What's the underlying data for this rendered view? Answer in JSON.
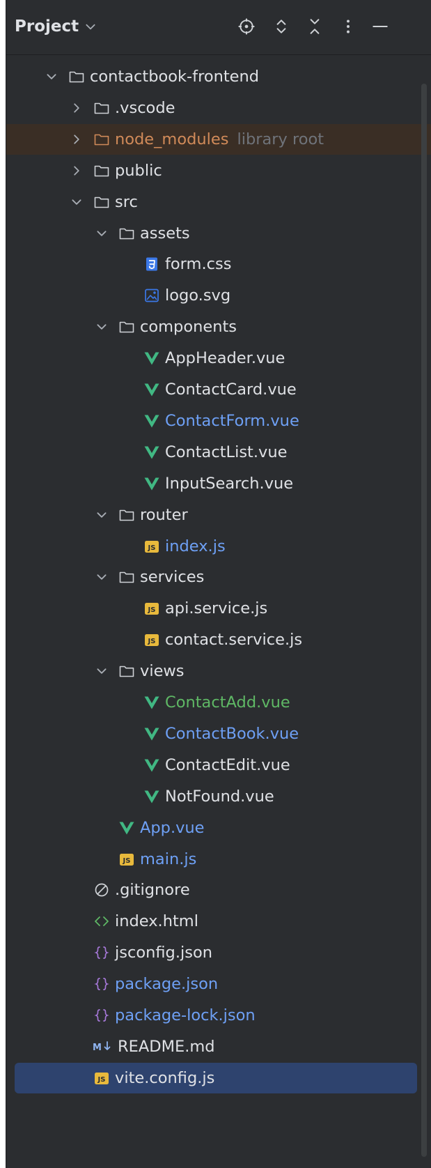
{
  "header": {
    "title": "Project",
    "icons": [
      "chevron-down-icon",
      "locate-icon",
      "expand-all-icon",
      "collapse-all-icon",
      "more-options-icon",
      "minimize-icon"
    ]
  },
  "colors": {
    "panel_bg": "#2b2d30",
    "text_default": "#dfe1e5",
    "text_modified": "#6ea0f5",
    "text_added": "#5fb865",
    "text_excluded": "#d08a59",
    "hint": "#6f737a",
    "selection": "#2e436e",
    "excluded_row": "#3a2e25",
    "vue_green": "#41b883",
    "js_yellow": "#e8b93c",
    "css_blue": "#3b78e7",
    "json_purple": "#a678d8"
  },
  "tree": {
    "rows": [
      {
        "label": "contactbook-frontend",
        "level": 0,
        "arrow": "expanded",
        "icon": "folder-icon",
        "status": "default"
      },
      {
        "label": ".vscode",
        "level": 1,
        "arrow": "collapsed",
        "icon": "folder-icon",
        "status": "default"
      },
      {
        "label": "node_modules",
        "level": 1,
        "arrow": "collapsed",
        "icon": "folder-excluded-icon",
        "status": "excluded",
        "hint": "library root"
      },
      {
        "label": "public",
        "level": 1,
        "arrow": "collapsed",
        "icon": "folder-icon",
        "status": "default"
      },
      {
        "label": "src",
        "level": 1,
        "arrow": "expanded",
        "icon": "folder-icon",
        "status": "default"
      },
      {
        "label": "assets",
        "level": 2,
        "arrow": "expanded",
        "icon": "folder-icon",
        "status": "default"
      },
      {
        "label": "form.css",
        "level": 3,
        "arrow": "none",
        "icon": "css-file-icon",
        "status": "default"
      },
      {
        "label": "logo.svg",
        "level": 3,
        "arrow": "none",
        "icon": "image-file-icon",
        "status": "default"
      },
      {
        "label": "components",
        "level": 2,
        "arrow": "expanded",
        "icon": "folder-icon",
        "status": "default"
      },
      {
        "label": "AppHeader.vue",
        "level": 3,
        "arrow": "none",
        "icon": "vue-file-icon",
        "status": "default"
      },
      {
        "label": "ContactCard.vue",
        "level": 3,
        "arrow": "none",
        "icon": "vue-file-icon",
        "status": "default"
      },
      {
        "label": "ContactForm.vue",
        "level": 3,
        "arrow": "none",
        "icon": "vue-file-icon",
        "status": "modified"
      },
      {
        "label": "ContactList.vue",
        "level": 3,
        "arrow": "none",
        "icon": "vue-file-icon",
        "status": "default"
      },
      {
        "label": "InputSearch.vue",
        "level": 3,
        "arrow": "none",
        "icon": "vue-file-icon",
        "status": "default"
      },
      {
        "label": "router",
        "level": 2,
        "arrow": "expanded",
        "icon": "folder-icon",
        "status": "default"
      },
      {
        "label": "index.js",
        "level": 3,
        "arrow": "none",
        "icon": "js-file-icon",
        "status": "modified"
      },
      {
        "label": "services",
        "level": 2,
        "arrow": "expanded",
        "icon": "folder-icon",
        "status": "default"
      },
      {
        "label": "api.service.js",
        "level": 3,
        "arrow": "none",
        "icon": "js-file-icon",
        "status": "default"
      },
      {
        "label": "contact.service.js",
        "level": 3,
        "arrow": "none",
        "icon": "js-file-icon",
        "status": "default"
      },
      {
        "label": "views",
        "level": 2,
        "arrow": "expanded",
        "icon": "folder-icon",
        "status": "default"
      },
      {
        "label": "ContactAdd.vue",
        "level": 3,
        "arrow": "none",
        "icon": "vue-file-icon",
        "status": "added"
      },
      {
        "label": "ContactBook.vue",
        "level": 3,
        "arrow": "none",
        "icon": "vue-file-icon",
        "status": "modified"
      },
      {
        "label": "ContactEdit.vue",
        "level": 3,
        "arrow": "none",
        "icon": "vue-file-icon",
        "status": "default"
      },
      {
        "label": "NotFound.vue",
        "level": 3,
        "arrow": "none",
        "icon": "vue-file-icon",
        "status": "default"
      },
      {
        "label": "App.vue",
        "level": 2,
        "arrow": "none",
        "icon": "vue-file-icon",
        "status": "modified"
      },
      {
        "label": "main.js",
        "level": 2,
        "arrow": "none",
        "icon": "js-file-icon",
        "status": "modified"
      },
      {
        "label": ".gitignore",
        "level": 1,
        "arrow": "none",
        "icon": "ignore-file-icon",
        "status": "default"
      },
      {
        "label": "index.html",
        "level": 1,
        "arrow": "none",
        "icon": "html-file-icon",
        "status": "default"
      },
      {
        "label": "jsconfig.json",
        "level": 1,
        "arrow": "none",
        "icon": "json-file-icon",
        "status": "default"
      },
      {
        "label": "package.json",
        "level": 1,
        "arrow": "none",
        "icon": "json-file-icon",
        "status": "modified"
      },
      {
        "label": "package-lock.json",
        "level": 1,
        "arrow": "none",
        "icon": "json-file-icon",
        "status": "modified"
      },
      {
        "label": "README.md",
        "level": 1,
        "arrow": "none",
        "icon": "markdown-file-icon",
        "status": "default"
      },
      {
        "label": "vite.config.js",
        "level": 1,
        "arrow": "none",
        "icon": "js-file-icon",
        "status": "default",
        "selected": true
      }
    ]
  }
}
